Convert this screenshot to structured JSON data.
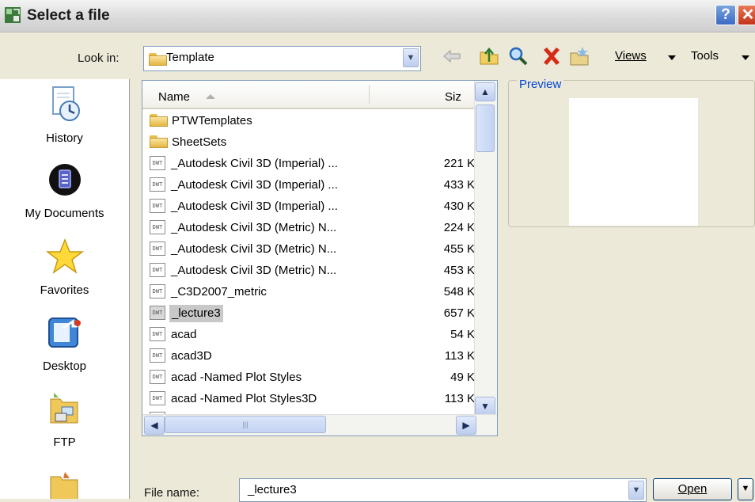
{
  "window": {
    "title": "Select a file",
    "help_label": "?",
    "close_label": "✕"
  },
  "toolbar": {
    "look_in_label": "Look in:",
    "look_in_value": "Template",
    "views_label": "Views",
    "tools_label": "Tools",
    "icons": [
      "back-arrow-icon",
      "up-folder-icon",
      "search-web-icon",
      "delete-icon",
      "create-folder-icon"
    ]
  },
  "places": {
    "items": [
      {
        "label": "History",
        "icon": "history-icon"
      },
      {
        "label": "My Documents",
        "icon": "my-documents-icon"
      },
      {
        "label": "Favorites",
        "icon": "favorites-star-icon"
      },
      {
        "label": "Desktop",
        "icon": "desktop-icon"
      },
      {
        "label": "FTP",
        "icon": "ftp-icon"
      }
    ]
  },
  "file_list": {
    "col_name": "Name",
    "col_size": "Siz",
    "rows": [
      {
        "name": "PTWTemplates",
        "size": "",
        "type": "folder"
      },
      {
        "name": "SheetSets",
        "size": "",
        "type": "folder"
      },
      {
        "name": "_Autodesk Civil 3D (Imperial) ...",
        "size": "221 K",
        "type": "dwt"
      },
      {
        "name": "_Autodesk Civil 3D (Imperial) ...",
        "size": "433 K",
        "type": "dwt"
      },
      {
        "name": "_Autodesk Civil 3D (Imperial) ...",
        "size": "430 K",
        "type": "dwt"
      },
      {
        "name": "_Autodesk Civil 3D (Metric) N...",
        "size": "224 K",
        "type": "dwt"
      },
      {
        "name": "_Autodesk Civil 3D (Metric) N...",
        "size": "455 K",
        "type": "dwt"
      },
      {
        "name": "_Autodesk Civil 3D (Metric) N...",
        "size": "453 K",
        "type": "dwt"
      },
      {
        "name": "_C3D2007_metric",
        "size": "548 K",
        "type": "dwt"
      },
      {
        "name": "_lecture3",
        "size": "657 K",
        "type": "dwt",
        "selected": true
      },
      {
        "name": "acad",
        "size": "54 K",
        "type": "dwt"
      },
      {
        "name": "acad3D",
        "size": "113 K",
        "type": "dwt"
      },
      {
        "name": "acad -Named Plot Styles",
        "size": "49 K",
        "type": "dwt"
      },
      {
        "name": "acad -Named Plot Styles3D",
        "size": "113 K",
        "type": "dwt"
      }
    ],
    "dwg_badge": "DWT",
    "scroll_grip": "|||"
  },
  "preview": {
    "label": "Preview"
  },
  "footer": {
    "file_name_label": "File name:",
    "file_name_value": "_lecture3",
    "open_label": "Open"
  }
}
